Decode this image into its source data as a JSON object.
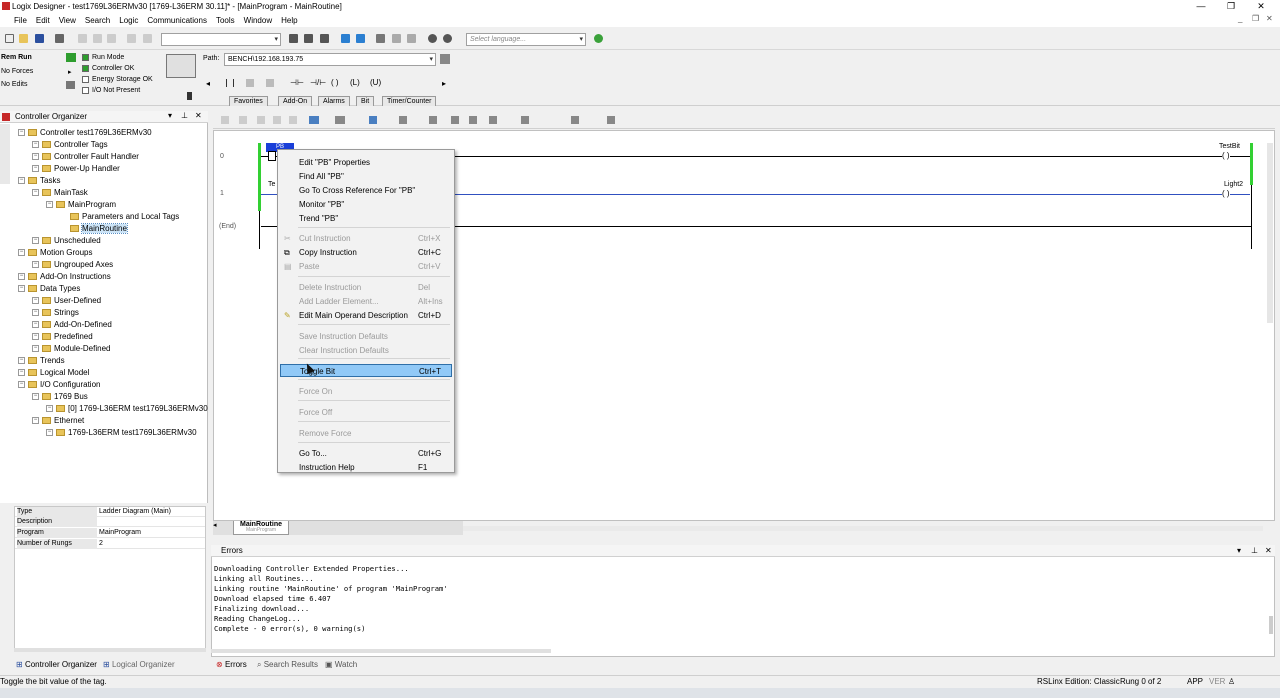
{
  "window": {
    "title": "Logix Designer - test1769L36ERMv30 [1769-L36ERM 30.11]* - [MainProgram - MainRoutine]",
    "controls": [
      "—",
      "❐",
      "✕"
    ]
  },
  "menubar": [
    "File",
    "Edit",
    "View",
    "Search",
    "Logic",
    "Communications",
    "Tools",
    "Window",
    "Help"
  ],
  "toolbar": {
    "path_label": "Path:",
    "path_value": "BENCH\\192.168.193.75",
    "language_placeholder": "Select language..."
  },
  "controller_status": {
    "mode": "Rem Run",
    "forces": "No Forces",
    "edits": "No Edits",
    "indicators": [
      "Run Mode",
      "Controller OK",
      "Energy Storage OK",
      "I/O Not Present"
    ]
  },
  "instruction_tabs": [
    "Favorites",
    "Add-On",
    "Alarms",
    "Bit",
    "Timer/Counter"
  ],
  "organizer": {
    "title": "Controller Organizer",
    "tree": [
      {
        "label": "Controller test1769L36ERMv30",
        "depth": 0,
        "top": 0
      },
      {
        "label": "Controller Tags",
        "depth": 1
      },
      {
        "label": "Controller Fault Handler",
        "depth": 1
      },
      {
        "label": "Power-Up Handler",
        "depth": 1
      },
      {
        "label": "Tasks",
        "depth": 0
      },
      {
        "label": "MainTask",
        "depth": 1
      },
      {
        "label": "MainProgram",
        "depth": 2
      },
      {
        "label": "Parameters and Local Tags",
        "depth": 3
      },
      {
        "label": "MainRoutine",
        "depth": 3
      },
      {
        "label": "Unscheduled",
        "depth": 1
      },
      {
        "label": "Motion Groups",
        "depth": 0
      },
      {
        "label": "Ungrouped Axes",
        "depth": 1
      },
      {
        "label": "Add-On Instructions",
        "depth": 0
      },
      {
        "label": "Data Types",
        "depth": 0
      },
      {
        "label": "User-Defined",
        "depth": 1
      },
      {
        "label": "Strings",
        "depth": 1
      },
      {
        "label": "Add-On-Defined",
        "depth": 1
      },
      {
        "label": "Predefined",
        "depth": 1
      },
      {
        "label": "Module-Defined",
        "depth": 1
      },
      {
        "label": "Trends",
        "depth": 0
      },
      {
        "label": "Logical Model",
        "depth": 0
      },
      {
        "label": "I/O Configuration",
        "depth": 0
      },
      {
        "label": "1769 Bus",
        "depth": 1
      },
      {
        "label": "[0] 1769-L36ERM test1769L36ERMv30",
        "depth": 2
      },
      {
        "label": "Ethernet",
        "depth": 1
      },
      {
        "label": "1769-L36ERM test1769L36ERMv30",
        "depth": 2
      }
    ],
    "tabs": [
      "Controller Organizer",
      "Logical Organizer"
    ]
  },
  "properties": [
    {
      "key": "Type",
      "value": "Ladder Diagram (Main)"
    },
    {
      "key": "Description",
      "value": ""
    },
    {
      "key": "Program",
      "value": "MainProgram"
    },
    {
      "key": "Number of Rungs",
      "value": "2"
    }
  ],
  "ladder": {
    "rungs": [
      "0",
      "1",
      "(End)"
    ],
    "instruction_tag": "PB",
    "rung1_partial": "Te",
    "coils": [
      "TestBit",
      "Light2"
    ],
    "routine_tab": "MainRoutine",
    "routine_tab_sub": "MainProgram"
  },
  "context_menu": [
    {
      "label": "Edit \"PB\" Properties",
      "shortcut": "",
      "disabled": false
    },
    {
      "label": "Find All \"PB\"",
      "shortcut": "",
      "disabled": false
    },
    {
      "label": "Go To Cross Reference For \"PB\"",
      "shortcut": "",
      "disabled": false
    },
    {
      "label": "Monitor \"PB\"",
      "shortcut": "",
      "disabled": false
    },
    {
      "label": "Trend \"PB\"",
      "shortcut": "",
      "disabled": false
    },
    {
      "label": "Cut Instruction",
      "shortcut": "Ctrl+X",
      "disabled": true
    },
    {
      "label": "Copy Instruction",
      "shortcut": "Ctrl+C",
      "disabled": false
    },
    {
      "label": "Paste",
      "shortcut": "Ctrl+V",
      "disabled": true
    },
    {
      "label": "Delete Instruction",
      "shortcut": "Del",
      "disabled": true
    },
    {
      "label": "Add Ladder Element...",
      "shortcut": "Alt+Ins",
      "disabled": true
    },
    {
      "label": "Edit Main Operand Description",
      "shortcut": "Ctrl+D",
      "disabled": false
    },
    {
      "label": "Save Instruction Defaults",
      "shortcut": "",
      "disabled": true
    },
    {
      "label": "Clear Instruction Defaults",
      "shortcut": "",
      "disabled": true
    },
    {
      "label": "Toggle Bit",
      "shortcut": "Ctrl+T",
      "disabled": false
    },
    {
      "label": "Force On",
      "shortcut": "",
      "disabled": true
    },
    {
      "label": "Force Off",
      "shortcut": "",
      "disabled": true
    },
    {
      "label": "Remove Force",
      "shortcut": "",
      "disabled": true
    },
    {
      "label": "Go To...",
      "shortcut": "Ctrl+G",
      "disabled": false
    },
    {
      "label": "Instruction Help",
      "shortcut": "F1",
      "disabled": false
    }
  ],
  "errors": {
    "title": "Errors",
    "lines": [
      "Downloading Controller Extended Properties...",
      "Linking all Routines...",
      "Linking routine 'MainRoutine' of program 'MainProgram'",
      "Download elapsed time 6.407",
      "Finalizing download...",
      "Reading ChangeLog...",
      "Complete - 0 error(s), 0 warning(s)"
    ],
    "tabs": [
      "Errors",
      "Search Results",
      "Watch"
    ]
  },
  "statusbar": {
    "hint": "Toggle the bit value of the tag.",
    "edition": "RSLinx Edition: Classic",
    "rung": "Rung 0 of 2",
    "app": "APP",
    "ver": "VER"
  }
}
